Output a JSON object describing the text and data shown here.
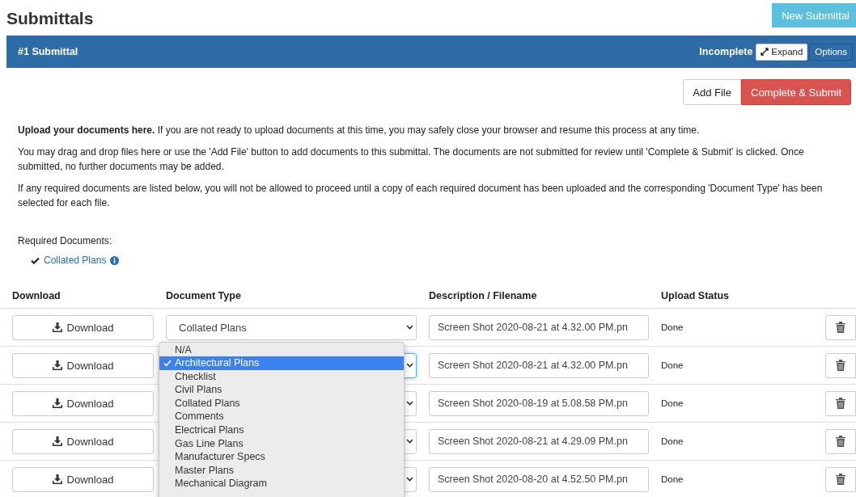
{
  "page": {
    "title": "Submittals",
    "new_button": "New Submittal"
  },
  "panel": {
    "title": "#1 Submittal",
    "status": "Incomplete",
    "expand_button": "Expand",
    "options_button": "Options"
  },
  "actions": {
    "add_file": "Add File",
    "complete": "Complete & Submit"
  },
  "instructions": [
    "**Upload your documents here.** If you are not ready to upload documents at this time, you may safely close your browser and resume this process at any time.",
    "You may drag and drop files here or use the 'Add File' button to add documents to this submittal. The documents are not submitted for review until 'Complete & Submit' is clicked. Once submitted, no further documents may be added.",
    "If any required documents are listed below, you will not be allowed to proceed until a copy of each required document has been uploaded and the corresponding 'Document Type' has been selected for each file."
  ],
  "required": {
    "label": "Required Documents:",
    "items": [
      {
        "name": "Collated Plans",
        "checked": true
      }
    ]
  },
  "table": {
    "columns": [
      "Download",
      "Document Type",
      "Description / Filename",
      "Upload Status"
    ],
    "rows": [
      {
        "download": "Download",
        "document_type": "Collated Plans",
        "focused": false,
        "filename": "Screen Shot 2020-08-21 at 4.32.00 PM.pn",
        "status": "Done"
      },
      {
        "download": "Download",
        "focused": true,
        "filename": "Screen Shot 2020-08-21 at 4.32.00 PM.pn",
        "status": "Done"
      },
      {
        "download": "Download",
        "focused": false,
        "filename": "Screen Shot 2020-08-19 at 5.08.58 PM.pn",
        "status": "Done"
      },
      {
        "download": "Download",
        "focused": false,
        "filename": "Screen Shot 2020-08-21 at 4.29.09 PM.pn",
        "status": "Done"
      },
      {
        "download": "Download",
        "focused": false,
        "filename": "Screen Shot 2020-08-20 at 4.52.50 PM.pn",
        "status": "Done"
      }
    ]
  },
  "dropdown": {
    "options": [
      {
        "label": "N/A",
        "selected": false
      },
      {
        "label": "Architectural Plans",
        "selected": true
      },
      {
        "label": "Checklist",
        "selected": false
      },
      {
        "label": "Civil Plans",
        "selected": false
      },
      {
        "label": "Collated Plans",
        "selected": false
      },
      {
        "label": "Comments",
        "selected": false
      },
      {
        "label": "Electrical Plans",
        "selected": false
      },
      {
        "label": "Gas Line Plans",
        "selected": false
      },
      {
        "label": "Manufacturer Specs",
        "selected": false
      },
      {
        "label": "Master Plans",
        "selected": false
      },
      {
        "label": "Mechanical Diagram",
        "selected": false
      }
    ]
  }
}
